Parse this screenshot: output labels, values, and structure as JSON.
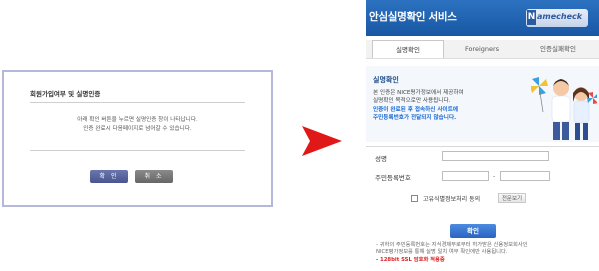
{
  "dialog": {
    "title": "회원가입여부 및 실명인증",
    "message_line1": "아래 확인 버튼을 누르면 실명인증 창이 나타납니다.",
    "message_line2": "인증 완료시 다음페이지로 넘어갈 수 있습니다.",
    "ok_label": "확 인",
    "cancel_label": "취 소"
  },
  "window": {
    "title": "안심실명확인 서비스",
    "logo_text": "amecheck",
    "logo_letter": "N",
    "tabs": [
      {
        "label": "실명확인",
        "active": true
      },
      {
        "label": "Foreigners",
        "active": false
      },
      {
        "label": "인증실패확인",
        "active": false
      }
    ],
    "hero": {
      "title": "실명확인",
      "line1": "본 인증은 NICE평가정보에서 제공하여",
      "line2": "실명확인 목적으로만 사용됩니다.",
      "line3": "인증이 완료된 후 접속하신 사이트에",
      "line4": "주민등록번호가 전달되지 않습니다."
    },
    "form": {
      "name_label": "성명",
      "rrn_label": "주민등록번호",
      "dash": "-",
      "consent_label": "고유식별정보처리 동의",
      "view_button": "전문보기"
    },
    "confirm_label": "확인",
    "notes": [
      "- 귀하의 주민등록번호는 지식경제부로부터 허가받은 신용정보회사인",
      "  NICE평가정보를 통해 실명 일치 여부 확인에만 사용됩니다.",
      "- 128bit SSL 암호화 적용중"
    ]
  },
  "colors": {
    "header_blue": "#1f62b0",
    "arrow_red": "#e11818",
    "dialog_border": "#b6b8db"
  }
}
